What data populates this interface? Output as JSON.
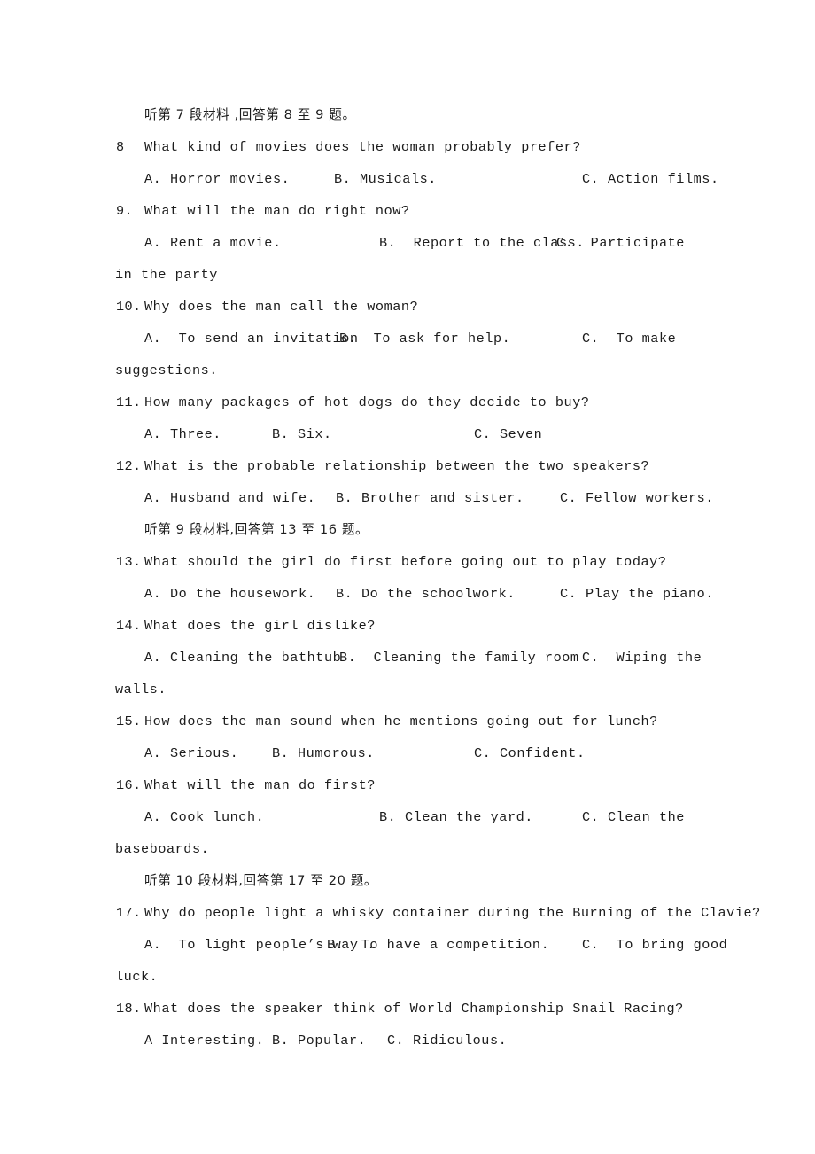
{
  "document": {
    "type": "english-listening-exam-page",
    "background_color": "#ffffff",
    "text_color": "#1c1c1c"
  },
  "sections": {
    "header_7": "听第 7 段材料 ,回答第 8 至 9 题。",
    "header_9": "听第 9 段材料,回答第 13 至 16 题。",
    "header_10": "听第 10 段材料,回答第 17 至 20 题。"
  },
  "questions": [
    {
      "number": "8",
      "stem": "What kind of movies does the woman probably prefer?",
      "options": {
        "a": "A. Horror movies.",
        "b": "B. Musicals.",
        "c": "C. Action films."
      }
    },
    {
      "number": "9.",
      "stem": "What will the man do right now?",
      "options": {
        "a": "A. Rent a movie.",
        "b": "B.  Report to the class.",
        "c": "C.  Participate"
      },
      "continuation": "in the party"
    },
    {
      "number": "10.",
      "stem": "Why does the man call the woman?",
      "options": {
        "a": "A.  To send an invitation",
        "b": "B.  To ask for help.",
        "c": "C.  To make"
      },
      "continuation": "suggestions."
    },
    {
      "number": "11.",
      "stem": "How many packages of hot dogs do they decide to buy?",
      "options": {
        "a": "A. Three.",
        "b": "B. Six.",
        "c": "C. Seven"
      }
    },
    {
      "number": "12.",
      "stem": "What is the probable relationship between the two speakers?",
      "options": {
        "a": "A. Husband and wife.",
        "b": "B. Brother and sister.",
        "c": "C. Fellow workers."
      }
    },
    {
      "number": "13.",
      "stem": "What should the girl do first before going out to play today?",
      "options": {
        "a": "A. Do the housework.",
        "b": "B. Do the schoolwork.",
        "c": "C. Play the piano."
      }
    },
    {
      "number": "14.",
      "stem": "What does the girl dislike?",
      "options": {
        "a": "A. Cleaning the bathtub",
        "b": "B.  Cleaning the family room",
        "c": "C.  Wiping the"
      },
      "continuation": "walls."
    },
    {
      "number": "15.",
      "stem": "How does the man sound when he mentions going out for lunch?",
      "options": {
        "a": "A. Serious.",
        "b": "B. Humorous.",
        "c": "C. Confident."
      }
    },
    {
      "number": "16.",
      "stem": "What will the man do first?",
      "options": {
        "a": "A. Cook lunch.",
        "b": "B. Clean the yard.",
        "c": "C. Clean the"
      },
      "continuation": "baseboards."
    },
    {
      "number": "17.",
      "stem": "Why do people light a whisky container during the Burning of the Clavie?",
      "options": {
        "a": "A.  To light people’s way .",
        "b": "B.  To have a competition.",
        "c": "C.  To bring good"
      },
      "continuation": "luck."
    },
    {
      "number": "18.",
      "stem": "What does the speaker think of World Championship Snail Racing?",
      "options": {
        "a": "A Interesting.",
        "b": "B. Popular.",
        "c": "C. Ridiculous."
      }
    }
  ]
}
